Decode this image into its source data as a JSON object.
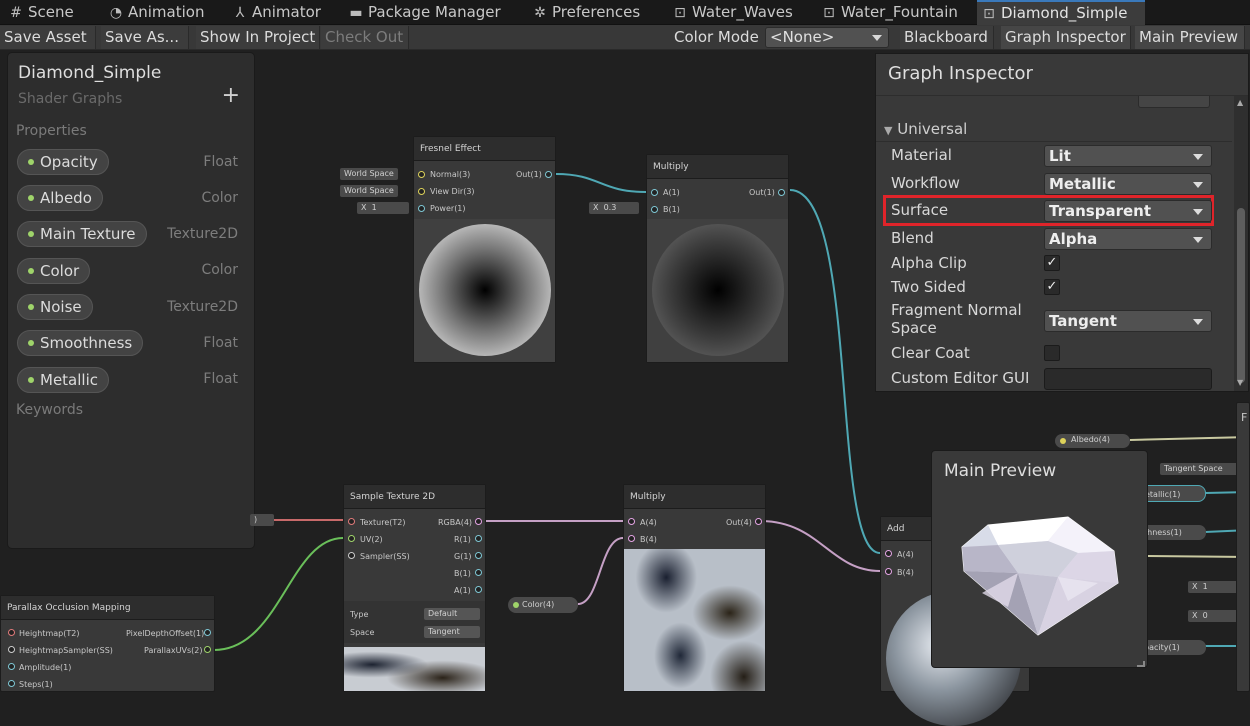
{
  "tabs": [
    {
      "label": "Scene",
      "icon": "grid-icon"
    },
    {
      "label": "Animation",
      "icon": "clock-icon"
    },
    {
      "label": "Animator",
      "icon": "animator-icon"
    },
    {
      "label": "Package Manager",
      "icon": "package-icon"
    },
    {
      "label": "Preferences",
      "icon": "gear-icon"
    },
    {
      "label": "Water_Waves",
      "icon": "shader-icon"
    },
    {
      "label": "Water_Fountain",
      "icon": "shader-icon"
    },
    {
      "label": "Diamond_Simple",
      "icon": "shader-icon"
    }
  ],
  "toolbar": {
    "save_asset": "Save Asset",
    "save_as": "Save As...",
    "show_in_project": "Show In Project",
    "check_out": "Check Out",
    "color_mode_label": "Color Mode",
    "color_mode_value": "<None>",
    "blackboard": "Blackboard",
    "graph_inspector": "Graph Inspector",
    "main_preview": "Main Preview"
  },
  "blackboard": {
    "title": "Diamond_Simple",
    "subtitle": "Shader Graphs",
    "plus": "+",
    "properties_label": "Properties",
    "keywords_label": "Keywords",
    "properties": [
      {
        "name": "Opacity",
        "type": "Float"
      },
      {
        "name": "Albedo",
        "type": "Color"
      },
      {
        "name": "Main Texture",
        "type": "Texture2D"
      },
      {
        "name": "Color",
        "type": "Color"
      },
      {
        "name": "Noise",
        "type": "Texture2D"
      },
      {
        "name": "Smoothness",
        "type": "Float"
      },
      {
        "name": "Metallic",
        "type": "Float"
      }
    ]
  },
  "nodes": {
    "fresnel": {
      "title": "Fresnel Effect",
      "in1": "Normal(3)",
      "in2": "View Dir(3)",
      "in3": "Power(1)",
      "out": "Out(1)",
      "chip1": "World Space",
      "chip2": "World Space",
      "chip3_x": "X",
      "chip3_v": "1"
    },
    "multiply1": {
      "title": "Multiply",
      "in1": "A(1)",
      "in2": "B(1)",
      "out": "Out(1)",
      "chip_x": "X",
      "chip_v": "0.3"
    },
    "sample": {
      "title": "Sample Texture 2D",
      "in1": "Texture(T2)",
      "in2": "UV(2)",
      "in3": "Sampler(SS)",
      "out1": "RGBA(4)",
      "out2": "R(1)",
      "out3": "G(1)",
      "out4": "B(1)",
      "out5": "A(1)",
      "type_label": "Type",
      "type_value": "Default",
      "space_label": "Space",
      "space_value": "Tangent"
    },
    "multiply2": {
      "title": "Multiply",
      "in1": "A(4)",
      "in2": "B(4)",
      "out": "Out(4)"
    },
    "color_chip": "Color(4)",
    "pom": {
      "title": "Parallax Occlusion Mapping",
      "in1": "Heightmap(T2)",
      "in2": "HeightmapSampler(SS)",
      "in3": "Amplitude(1)",
      "in4": "Steps(1)",
      "out1": "PixelDepthOffset(1)",
      "out2": "ParallaxUVs(2)"
    },
    "add": {
      "title": "Add",
      "in1": "A(4)",
      "in2": "B(4)"
    },
    "right": {
      "albedo": "Albedo(4)",
      "tangent": "Tangent Space",
      "metallic": "etallic(1)",
      "smooth": "thness(1)",
      "x1": "X",
      "v1": "1",
      "x2": "X",
      "v2": "0",
      "opacity": "pacity(1)",
      "f": "F"
    }
  },
  "inspector": {
    "title": "Graph Inspector",
    "section": "Universal",
    "rows": [
      {
        "label": "Material",
        "value": "Lit"
      },
      {
        "label": "Workflow",
        "value": "Metallic"
      },
      {
        "label": "Surface",
        "value": "Transparent"
      },
      {
        "label": "Blend",
        "value": "Alpha"
      },
      {
        "label": "Alpha Clip",
        "checked": "✓"
      },
      {
        "label": "Two Sided",
        "checked": "✓"
      },
      {
        "label": "Fragment Normal Space",
        "value": "Tangent"
      },
      {
        "label": "Clear Coat",
        "checked": ""
      },
      {
        "label": "Custom Editor GUI",
        "value": ""
      }
    ],
    "highlight_color": "#e0242a"
  },
  "preview": {
    "title": "Main Preview"
  }
}
